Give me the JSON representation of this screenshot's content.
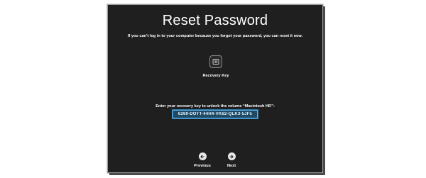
{
  "screen": {
    "title": "Reset Password",
    "subtitle": "If you can’t log in to your computer because you forgot your password, you can reset it now."
  },
  "method": {
    "icon": "recovery-key-icon",
    "label": "Recovery Key"
  },
  "recovery": {
    "prompt": "Enter your recovery key to unlock the volume “Macintosh HD”:",
    "key_value": "6269-DOTT-44H4-VK62-QLK3-5JF5"
  },
  "navigation": {
    "previous_label": "Previous",
    "previous_icon": "arrow-left-icon",
    "next_label": "Next",
    "next_icon": "arrow-right-icon"
  },
  "colors": {
    "background": "#1f1f1f",
    "field_fill": "#1f4a66",
    "field_border": "#5fb4e8",
    "text": "#ffffff"
  }
}
